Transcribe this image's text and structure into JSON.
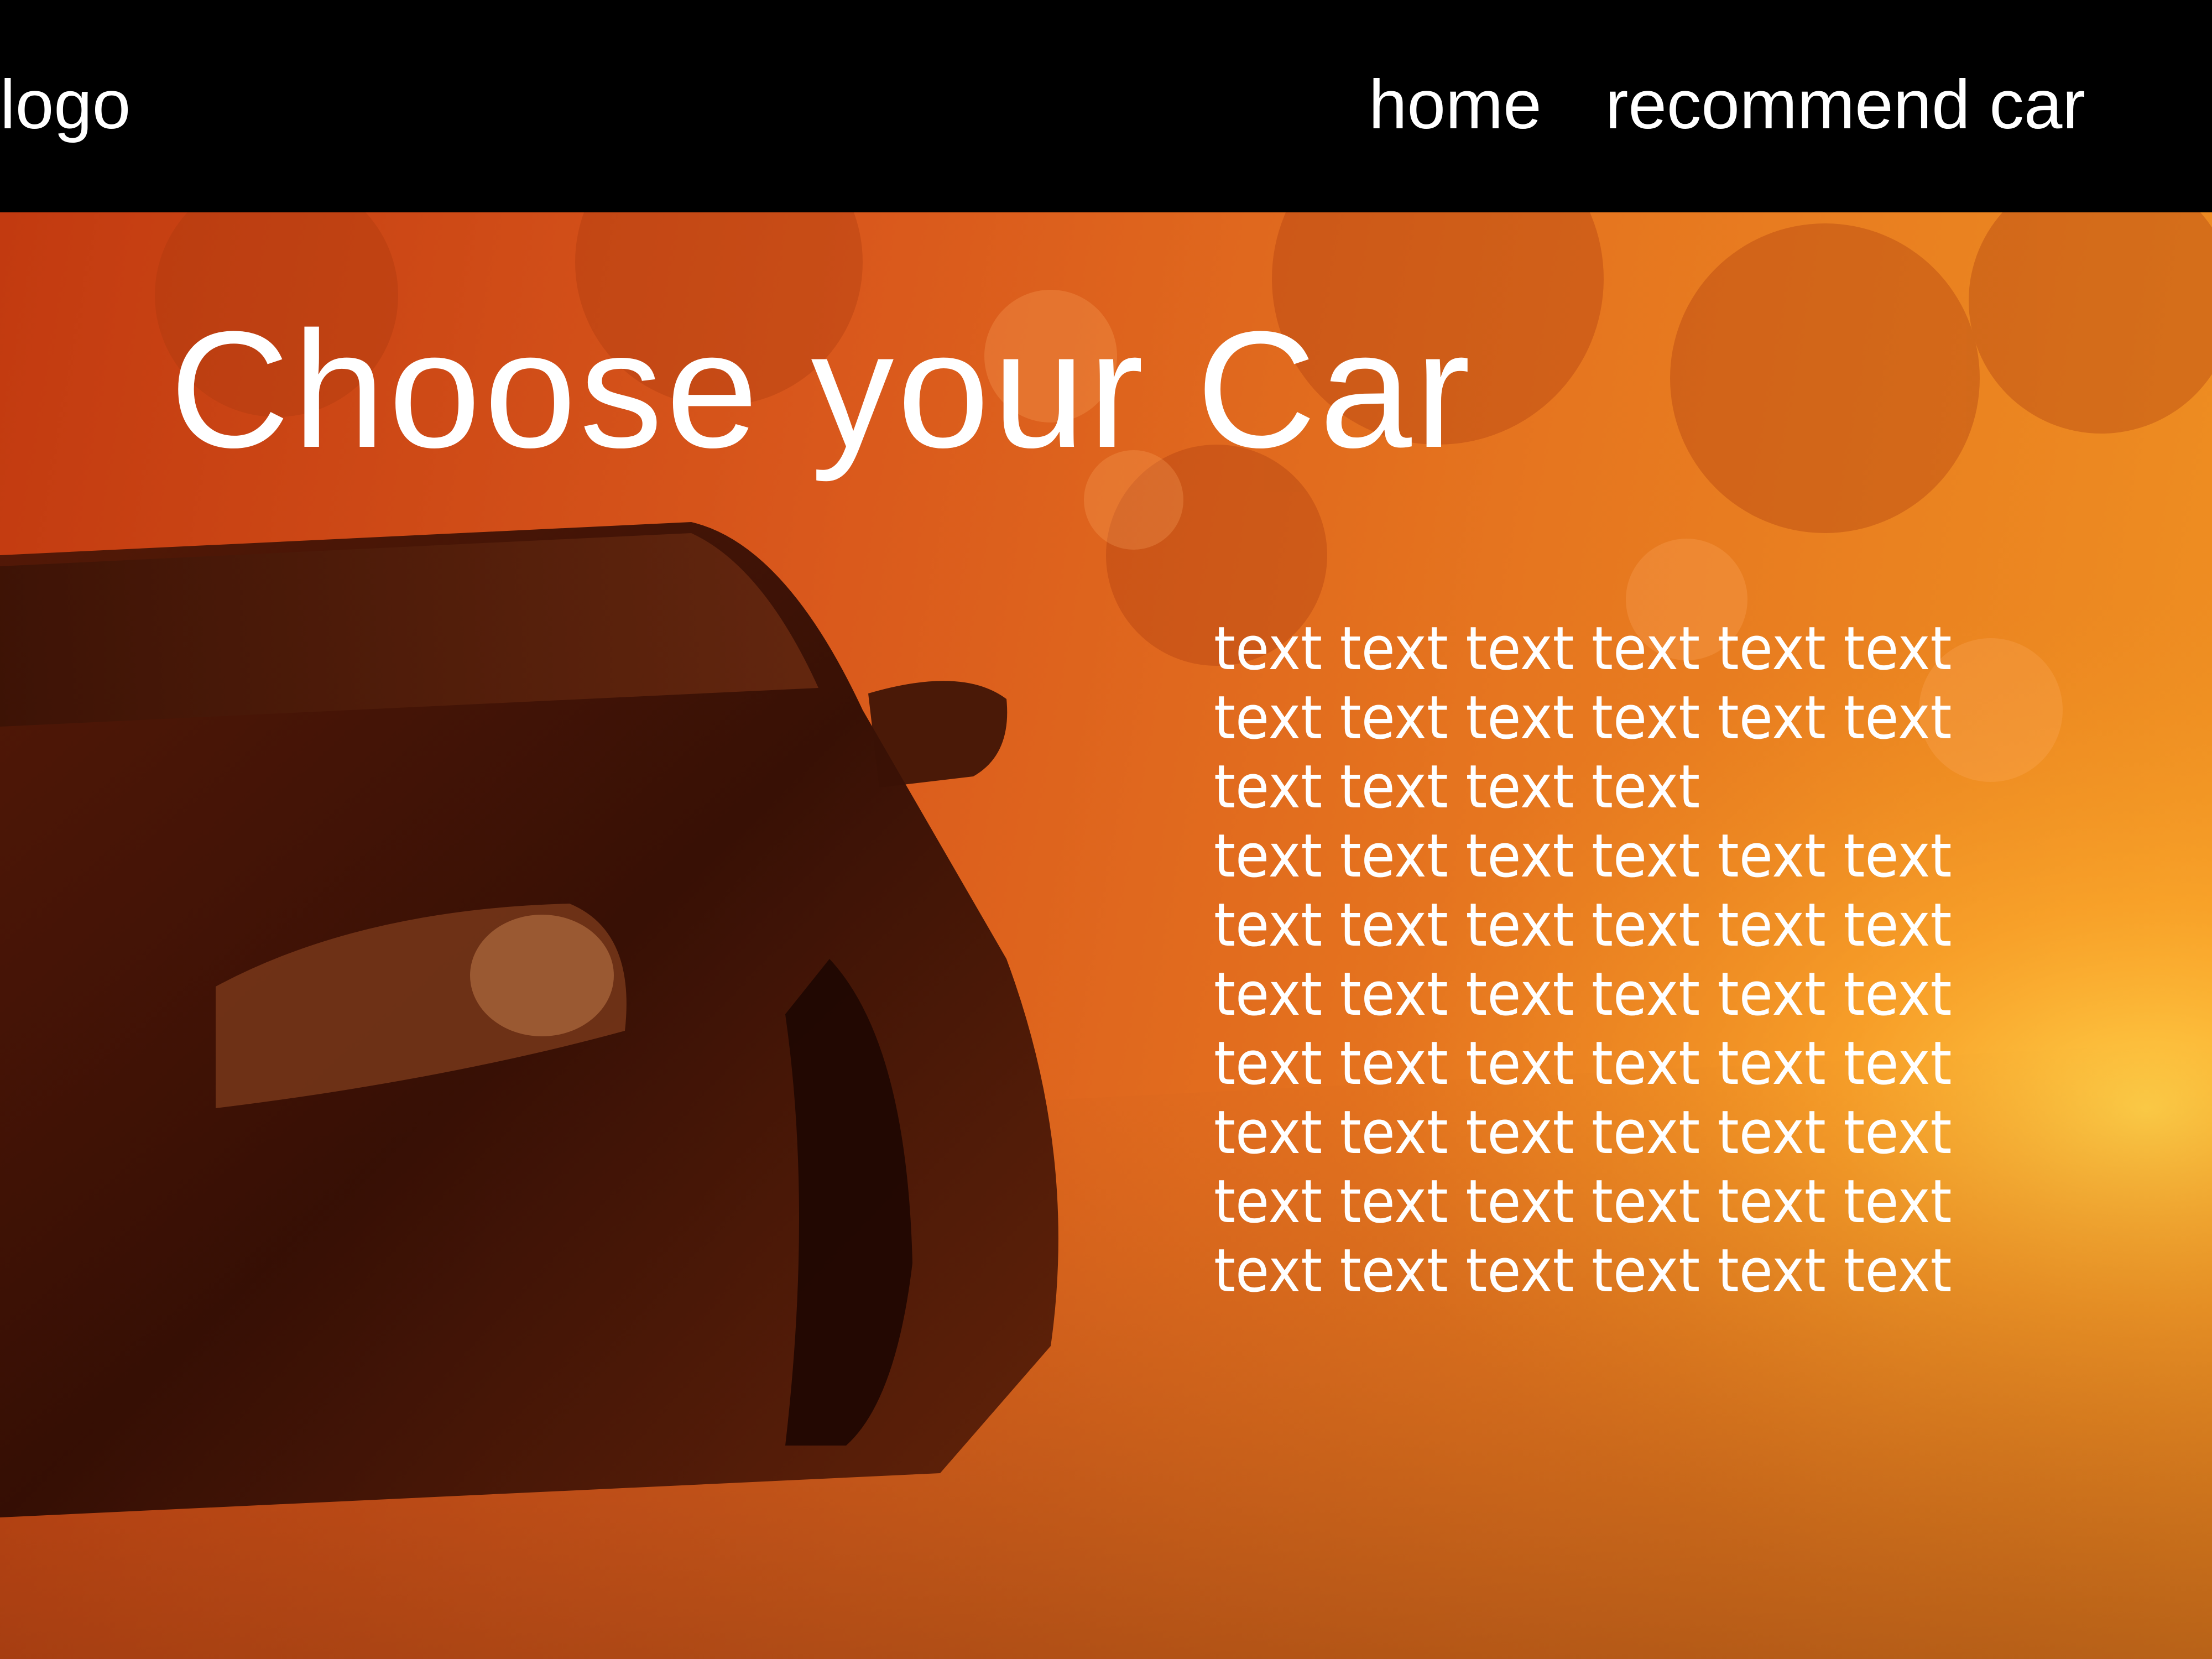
{
  "header": {
    "logo": "logo",
    "nav": {
      "home": "home",
      "recommend": "recommend car"
    }
  },
  "hero": {
    "title": "Choose your Car",
    "body": "text text text text text text\ntext text text text text text\ntext text text text\ntext text text text text text\ntext text text text text text\ntext text text text text text\ntext text text text text text\ntext text text text text text\ntext text text text text text\ntext text text text text text"
  },
  "colors": {
    "header_bg": "#000000",
    "text": "#ffffff",
    "overlay_left": "#c23a10",
    "overlay_right": "#f09322"
  }
}
